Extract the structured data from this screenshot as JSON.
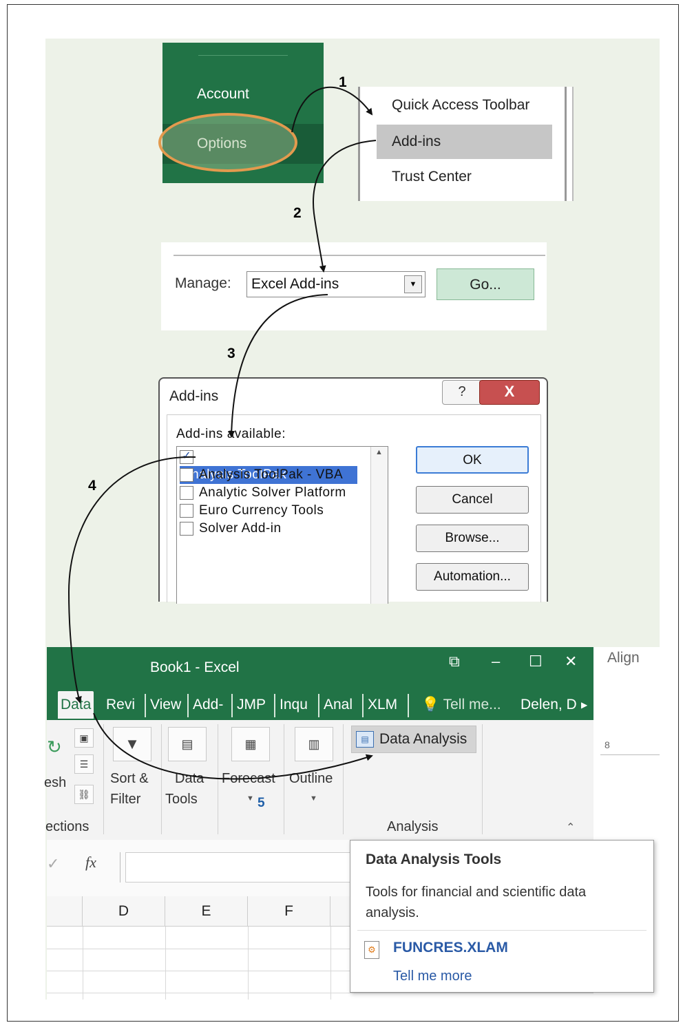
{
  "step_numbers": [
    "1",
    "2",
    "3",
    "4",
    "5"
  ],
  "backstage": {
    "items": [
      "Account",
      "Options"
    ]
  },
  "options_nav": {
    "items": [
      "Quick Access Toolbar",
      "Add-ins",
      "Trust Center"
    ]
  },
  "manage": {
    "label": "Manage:",
    "value": "Excel Add-ins",
    "go_label": "Go..."
  },
  "addins_dialog": {
    "title": "Add-ins",
    "help_icon": "?",
    "close_icon": "X",
    "available_label": "Add-ins available:",
    "items": [
      {
        "label": "Analysis ToolPak",
        "checked": true,
        "selected": true
      },
      {
        "label": "Analysis ToolPak - VBA",
        "checked": false,
        "selected": false
      },
      {
        "label": "Analytic Solver Platform",
        "checked": false,
        "selected": false
      },
      {
        "label": "Euro Currency Tools",
        "checked": false,
        "selected": false
      },
      {
        "label": "Solver Add-in",
        "checked": false,
        "selected": false
      }
    ],
    "buttons": [
      "OK",
      "Cancel",
      "Browse...",
      "Automation..."
    ]
  },
  "excel": {
    "window_title": "Book1 - Excel",
    "window_controls": [
      "⧉",
      "–",
      "☐",
      "✕"
    ],
    "tabs": [
      "Data",
      "Revi",
      "View",
      "Add-",
      "JMP",
      "Inqu",
      "Anal",
      "XLM"
    ],
    "tell_me": "Tell me...",
    "user": "Delen, D",
    "side_texts": [
      "Align",
      "8"
    ],
    "groups": {
      "refresh_lbl1": "esh",
      "connections_lbl": "ections",
      "sort_filter": [
        "Sort &",
        "Filter"
      ],
      "data_tools": [
        "Data",
        "Tools"
      ],
      "forecast": "Forecast",
      "outline": "Outline",
      "data_analysis": "Data Analysis",
      "analysis_lbl": "Analysis"
    },
    "formula_fx": "fx",
    "columns": [
      "D",
      "E",
      "F"
    ]
  },
  "tooltip": {
    "heading": "Data Analysis Tools",
    "description": "Tools for financial and scientific data analysis.",
    "link_file": "FUNCRES.XLAM",
    "tell_more": "Tell me more"
  },
  "colors": {
    "excel_green": "#217346",
    "oval": "#e39a4e",
    "selection_blue": "#3f73d4",
    "link_blue": "#2a5aa6"
  }
}
